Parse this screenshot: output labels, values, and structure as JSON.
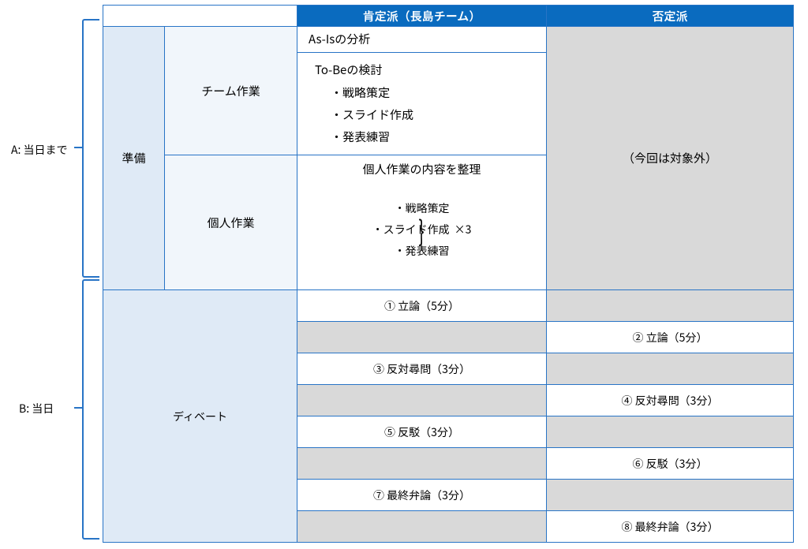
{
  "side": {
    "a": "A: 当日まで",
    "b": "B: 当日"
  },
  "header": {
    "affirm": "肯定派（長島チーム）",
    "negate": "否定派"
  },
  "phase": {
    "prep": "準備",
    "debate": "ディベート"
  },
  "sub": {
    "team": "チーム作業",
    "indiv": "個人作業"
  },
  "prep": {
    "team_asis": "As-Isの分析",
    "team_tobe": "To-Beの検討",
    "strategy": "戦略策定",
    "slides": "スライド作成",
    "practice": "発表練習",
    "indiv_header": "個人作業の内容を整理",
    "na_note": "（今回は対象外）"
  },
  "debate": {
    "r1_a": "① 立論（5分）",
    "r1_n": "",
    "r2_a": "",
    "r2_n": "② 立論（5分）",
    "r3_a": "③ 反対尋問（3分）",
    "r3_n": "",
    "r4_a": "",
    "r4_n": "④ 反対尋問（3分）",
    "r5_a": "⑤ 反駁（3分）",
    "r5_n": "",
    "r6_a": "",
    "r6_n": "⑥ 反駁（3分）",
    "r7_a": "⑦ 最終弁論（3分）",
    "r7_n": "",
    "r8_a": "",
    "r8_n": "⑧ 最終弁論（3分）"
  }
}
